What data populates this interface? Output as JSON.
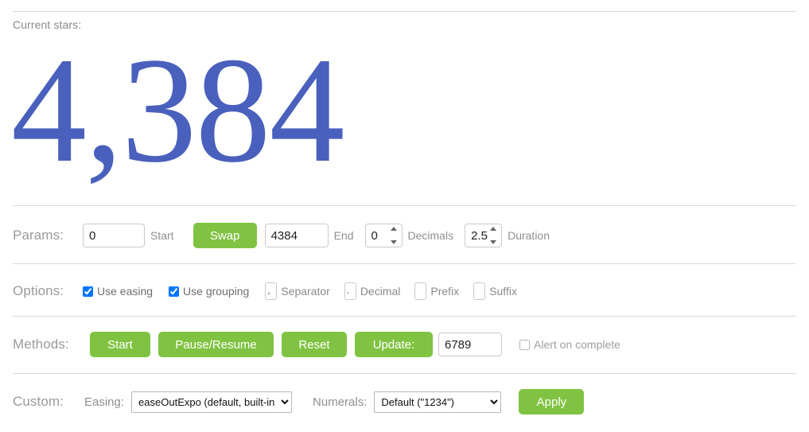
{
  "header": {
    "current_label": "Current stars:",
    "counter_value": "4,384",
    "counter_color": "#4a60bd"
  },
  "params": {
    "row_label": "Params:",
    "start_value": "0",
    "start_label": "Start",
    "swap_label": "Swap",
    "end_value": "4384",
    "end_label": "End",
    "decimals_value": "0",
    "decimals_label": "Decimals",
    "duration_value": "2.5",
    "duration_label": "Duration"
  },
  "options": {
    "row_label": "Options:",
    "use_easing_label": "Use easing",
    "use_easing_checked": true,
    "use_grouping_label": "Use grouping",
    "use_grouping_checked": true,
    "separator_value": ",",
    "separator_label": "Separator",
    "decimal_value": ".",
    "decimal_label": "Decimal",
    "prefix_value": "",
    "prefix_label": "Prefix",
    "suffix_value": "",
    "suffix_label": "Suffix"
  },
  "methods": {
    "row_label": "Methods:",
    "start_label": "Start",
    "pause_resume_label": "Pause/Resume",
    "reset_label": "Reset",
    "update_label": "Update:",
    "update_value": "6789",
    "alert_label": "Alert on complete",
    "alert_checked": false
  },
  "custom": {
    "row_label": "Custom:",
    "easing_label": "Easing:",
    "easing_selected": "easeOutExpo (default, built-in)",
    "numerals_label": "Numerals:",
    "numerals_selected": "Default (\"1234\")",
    "apply_label": "Apply"
  },
  "theme": {
    "accent_green": "#80c342",
    "divider": "#d8d8d8",
    "label_gray": "#9a9a9a"
  }
}
